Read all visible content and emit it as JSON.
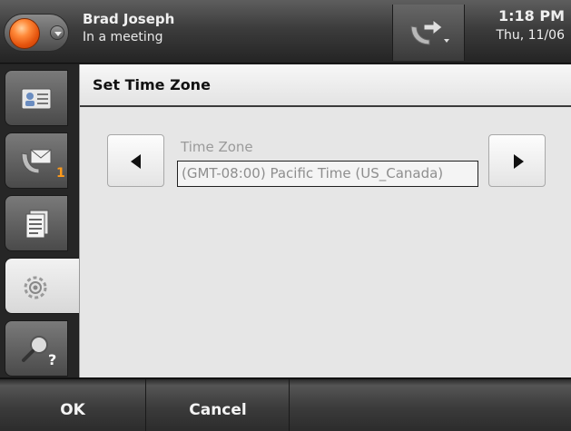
{
  "status_bar": {
    "user_name": "Brad Joseph",
    "presence_status": "In a meeting",
    "time": "1:18 PM",
    "date": "Thu, 11/06",
    "presence_color": "#e8651a"
  },
  "sidebar": {
    "items": [
      {
        "icon": "contacts-icon",
        "active": false
      },
      {
        "icon": "voicemail-icon",
        "badge": "1",
        "active": false
      },
      {
        "icon": "call-log-icon",
        "active": false
      },
      {
        "icon": "settings-icon",
        "active": true
      },
      {
        "icon": "help-icon",
        "active": false
      }
    ],
    "badge_color": "#ff9a1a"
  },
  "main": {
    "title": "Set Time Zone",
    "field_label": "Time Zone",
    "field_value": "(GMT-08:00) Pacific Time (US_Canada)"
  },
  "softkeys": {
    "ok": "OK",
    "cancel": "Cancel"
  }
}
